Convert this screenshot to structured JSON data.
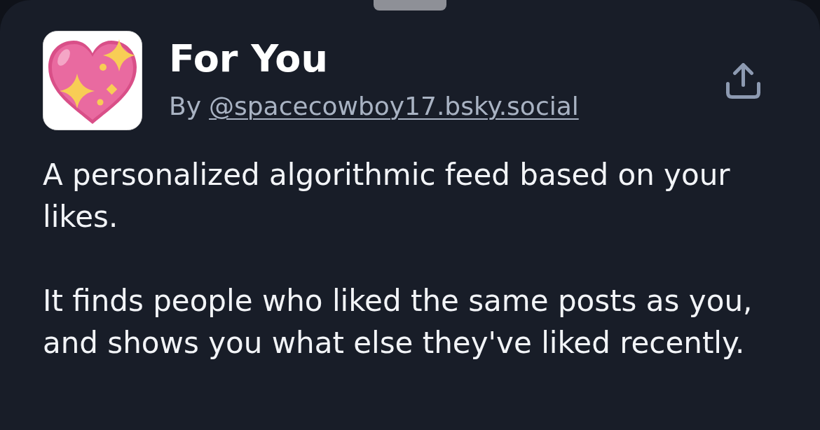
{
  "feed": {
    "title": "For You",
    "byline": {
      "prefix": "By",
      "handle": "@spacecowboy17.bsky.social"
    },
    "description": [
      "A personalized algorithmic feed based on your likes.",
      "It finds people who liked the same posts as you, and shows you what else they've liked recently."
    ]
  }
}
